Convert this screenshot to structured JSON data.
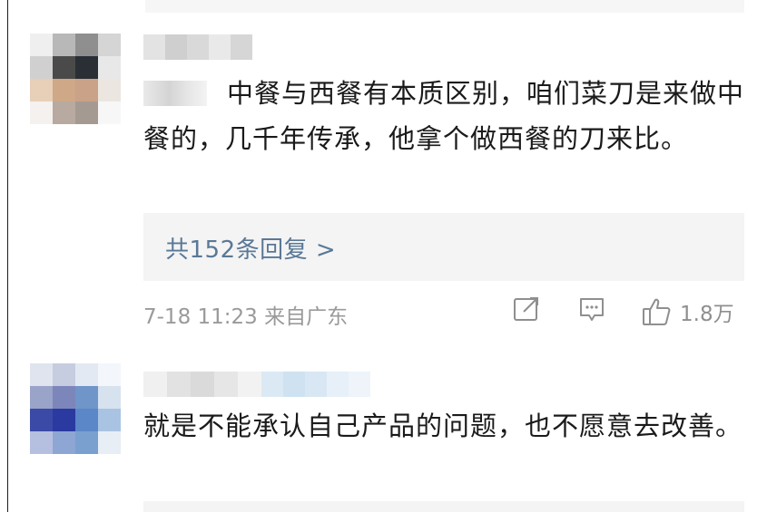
{
  "comments": [
    {
      "text": "中餐与西餐有本质区别，咱们菜刀是来做中餐的，几千年传承，他拿个做西餐的刀来比。",
      "replies_label": "共152条回复 >",
      "timestamp": "7-18 11:23 来自广东",
      "likes": "1.8万",
      "icons": [
        "share-icon",
        "comment-icon",
        "thumbs-up-icon"
      ]
    },
    {
      "text": "就是不能承认自己产品的问题，也不愿意去改善。"
    }
  ],
  "colors": {
    "text": "#1a1a1a",
    "link": "#5a7896",
    "meta": "#9a9a9a",
    "panel": "#f4f4f4"
  }
}
